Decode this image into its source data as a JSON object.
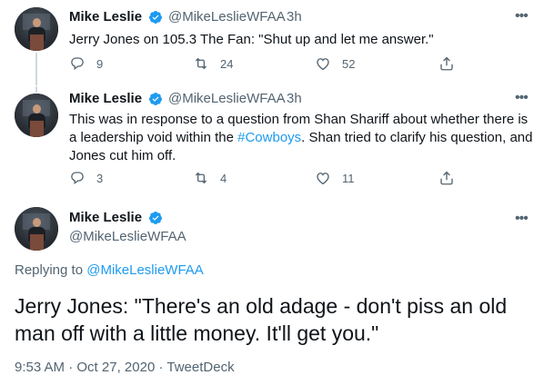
{
  "tweets": [
    {
      "name": "Mike Leslie",
      "handle": "@MikeLeslieWFAA",
      "separator": "·",
      "time": "3h",
      "text": "Jerry Jones on 105.3 The Fan: \"Shut up and let me answer.\"",
      "replies": "9",
      "retweets": "24",
      "likes": "52"
    },
    {
      "name": "Mike Leslie",
      "handle": "@MikeLeslieWFAA",
      "separator": "·",
      "time": "3h",
      "text_before": "This was in response to a question from Shan Shariff about whether there is a leadership void within the ",
      "hashtag": "#Cowboys",
      "text_after": ".  Shan tried to clarify his question, and Jones cut him off.",
      "replies": "3",
      "retweets": "4",
      "likes": "11"
    }
  ],
  "focused": {
    "name": "Mike Leslie",
    "handle": "@MikeLeslieWFAA",
    "replying_prefix": "Replying to ",
    "replying_handle": "@MikeLeslieWFAA",
    "text": "Jerry Jones: \"There's an old adage - don't piss an old man off with a little money.  It'll get you.\"",
    "time": "9:53 AM",
    "separator1": "·",
    "date": "Oct 27, 2020",
    "separator2": "·",
    "source": "TweetDeck"
  },
  "icons": {
    "verified": "verified-badge-icon",
    "reply": "reply-icon",
    "retweet": "retweet-icon",
    "like": "heart-icon",
    "share": "share-icon",
    "more": "more-icon"
  },
  "colors": {
    "accent": "#1d9bf0",
    "secondary_text": "#536471",
    "primary_text": "#0f1419",
    "thread_line": "#cfd9de"
  }
}
